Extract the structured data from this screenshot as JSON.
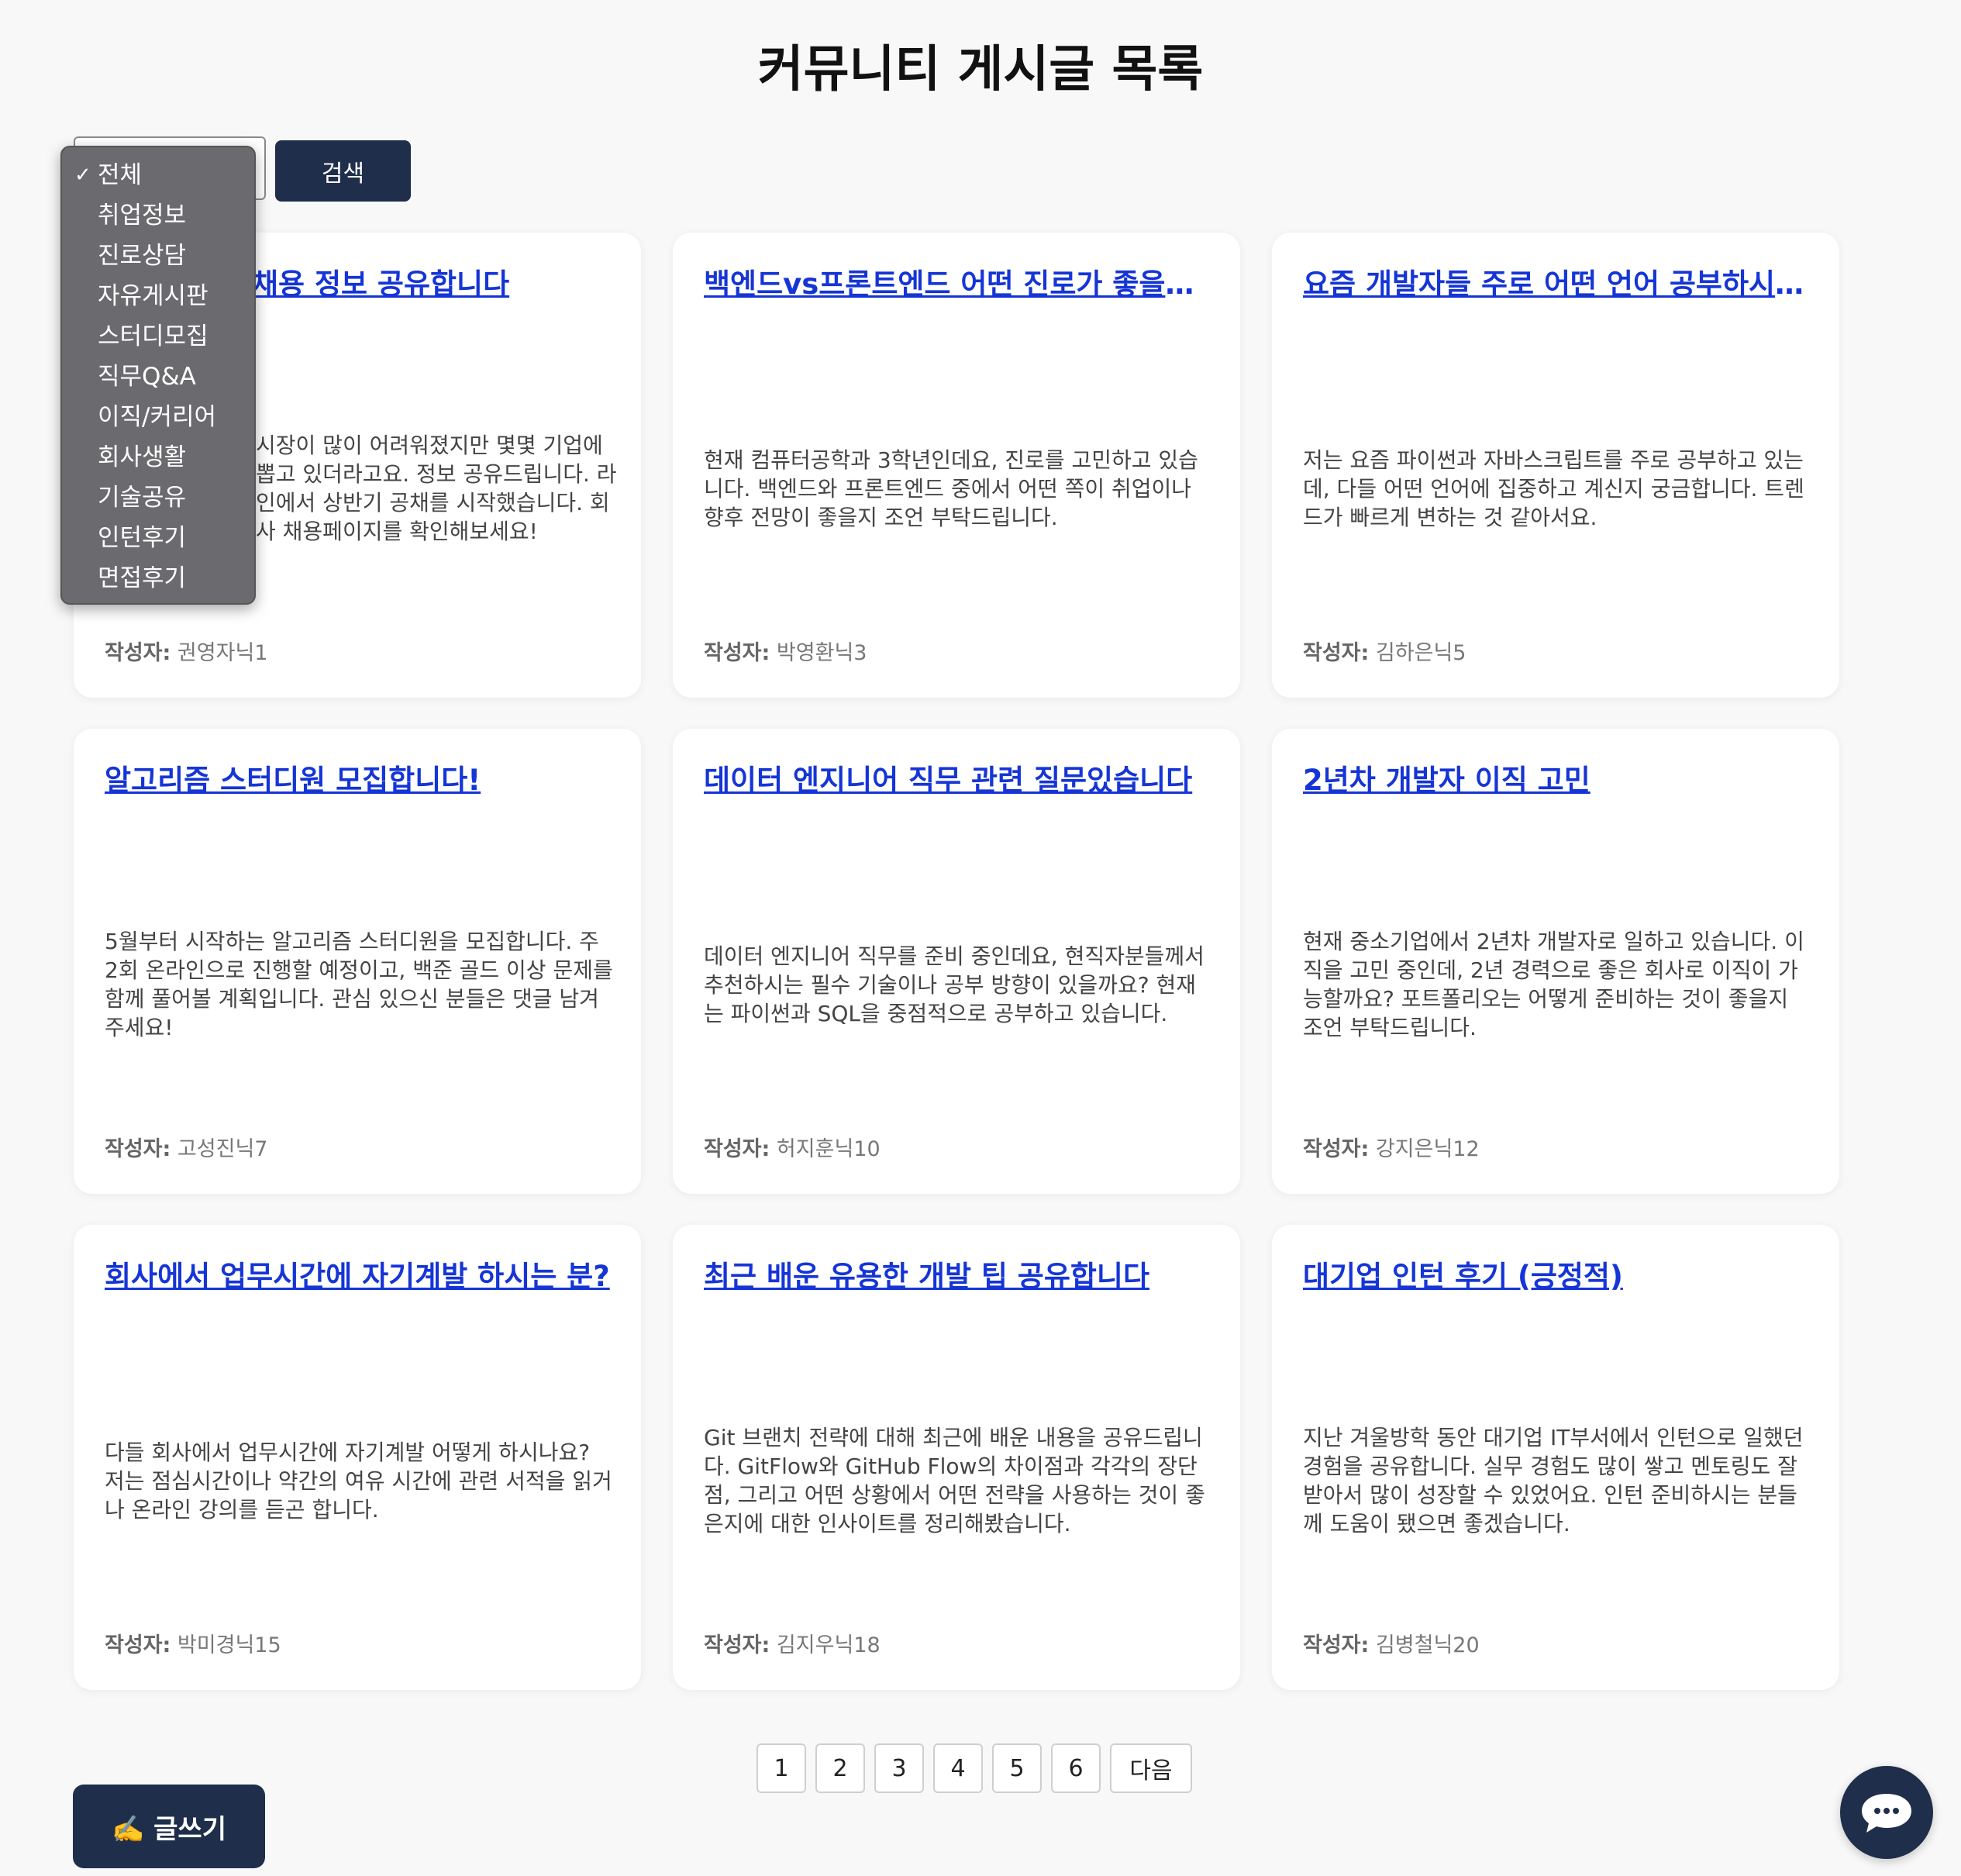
{
  "page": {
    "title": "커뮤니티 게시글 목록"
  },
  "filter": {
    "search_label": "검색",
    "selected_check": "✓",
    "options": [
      "전체",
      "취업정보",
      "진로상담",
      "자유게시판",
      "스터디모집",
      "직무Q&A",
      "이직/커리어",
      "회사생활",
      "기술공유",
      "인턴후기",
      "면접후기"
    ]
  },
  "posts": [
    {
      "title": "채용 정보 공유합니다",
      "body": "시장이 많이 어려워졌지만 몇몇 기업에 뽑고 있더라고요. 정보 공유드립니다. 라인에서 상반기 공채를 시작했습니다. 회사 채용페이지를 확인해보세요!",
      "author_label": "작성자:",
      "author": "권영자닉1"
    },
    {
      "title": "백엔드vs프론트엔드 어떤 진로가 좋을까요?",
      "body": "현재 컴퓨터공학과 3학년인데요, 진로를 고민하고 있습니다. 백엔드와 프론트엔드 중에서 어떤 쪽이 취업이나 향후 전망이 좋을지 조언 부탁드립니다.",
      "author_label": "작성자:",
      "author": "박영환닉3"
    },
    {
      "title": "요즘 개발자들 주로 어떤 언어 공부하시나요?",
      "body": "저는 요즘 파이썬과 자바스크립트를 주로 공부하고 있는데, 다들 어떤 언어에 집중하고 계신지 궁금합니다. 트렌드가 빠르게 변하는 것 같아서요.",
      "author_label": "작성자:",
      "author": "김하은닉5"
    },
    {
      "title": "알고리즘 스터디원 모집합니다!",
      "body": "5월부터 시작하는 알고리즘 스터디원을 모집합니다. 주 2회 온라인으로 진행할 예정이고, 백준 골드 이상 문제를 함께 풀어볼 계획입니다. 관심 있으신 분들은 댓글 남겨주세요!",
      "author_label": "작성자:",
      "author": "고성진닉7"
    },
    {
      "title": "데이터 엔지니어 직무 관련 질문있습니다",
      "body": "데이터 엔지니어 직무를 준비 중인데요, 현직자분들께서 추천하시는 필수 기술이나 공부 방향이 있을까요? 현재는 파이썬과 SQL을 중점적으로 공부하고 있습니다.",
      "author_label": "작성자:",
      "author": "허지훈닉10"
    },
    {
      "title": "2년차 개발자 이직 고민",
      "body": "현재 중소기업에서 2년차 개발자로 일하고 있습니다. 이직을 고민 중인데, 2년 경력으로 좋은 회사로 이직이 가능할까요? 포트폴리오는 어떻게 준비하는 것이 좋을지 조언 부탁드립니다.",
      "author_label": "작성자:",
      "author": "강지은닉12"
    },
    {
      "title": "회사에서 업무시간에 자기계발 하시는 분?",
      "body": "다들 회사에서 업무시간에 자기계발 어떻게 하시나요? 저는 점심시간이나 약간의 여유 시간에 관련 서적을 읽거나 온라인 강의를 듣곤 합니다.",
      "author_label": "작성자:",
      "author": "박미경닉15"
    },
    {
      "title": "최근 배운 유용한 개발 팁 공유합니다",
      "body": "Git 브랜치 전략에 대해 최근에 배운 내용을 공유드립니다. GitFlow와 GitHub Flow의 차이점과 각각의 장단점, 그리고 어떤 상황에서 어떤 전략을 사용하는 것이 좋은지에 대한 인사이트를 정리해봤습니다.",
      "author_label": "작성자:",
      "author": "김지우닉18"
    },
    {
      "title": "대기업 인턴 후기 (긍정적)",
      "body": "지난 겨울방학 동안 대기업 IT부서에서 인턴으로 일했던 경험을 공유합니다. 실무 경험도 많이 쌓고 멘토링도 잘 받아서 많이 성장할 수 있었어요. 인턴 준비하시는 분들께 도움이 됐으면 좋겠습니다.",
      "author_label": "작성자:",
      "author": "김병철닉20"
    }
  ],
  "pagination": {
    "pages": [
      "1",
      "2",
      "3",
      "4",
      "5",
      "6"
    ],
    "next_label": "다음"
  },
  "write_button": {
    "label": "✍️ 글쓰기"
  },
  "chat_button": {
    "icon": "chat-bubble-icon"
  },
  "colors": {
    "primary": "#1f2e4a",
    "link": "#1535d6",
    "background": "#f8f8f8"
  }
}
